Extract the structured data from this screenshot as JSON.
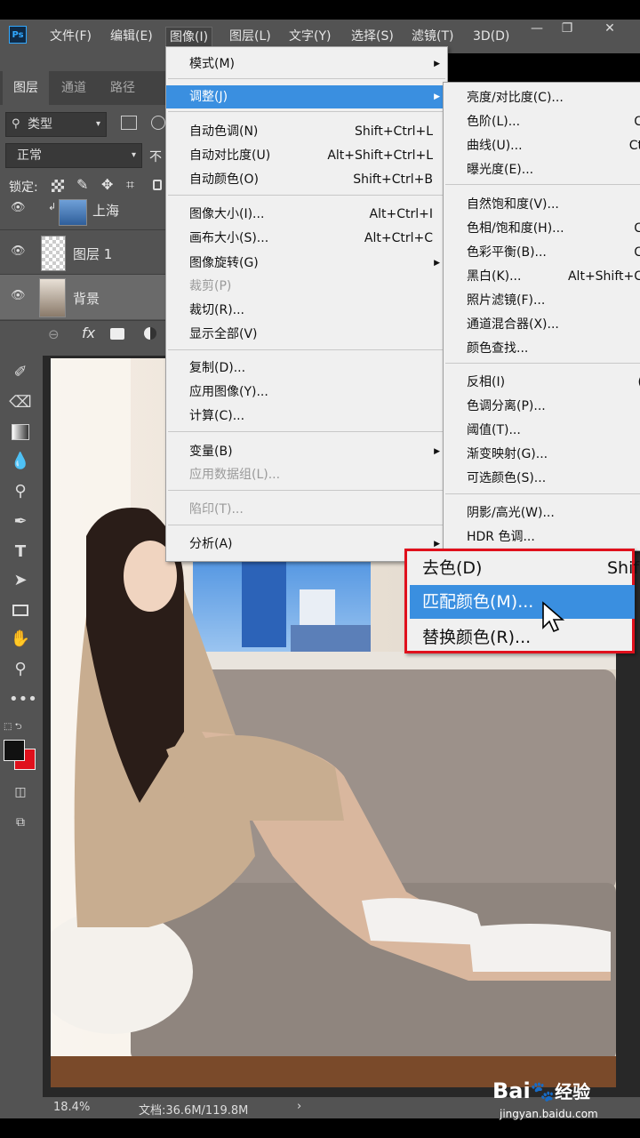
{
  "app": {
    "logo": "Ps"
  },
  "menubar": [
    "文件(F)",
    "编辑(E)",
    "图像(I)",
    "图层(L)",
    "文字(Y)",
    "选择(S)",
    "滤镜(T)",
    "3D(D)"
  ],
  "window_controls": [
    "—",
    "❐",
    "✕"
  ],
  "layers_panel": {
    "tabs": [
      "图层",
      "通道",
      "路径"
    ],
    "filter_label": "类型",
    "blend_mode": "正常",
    "opacity_label": "不",
    "lock_label": "锁定:",
    "layers": [
      {
        "name": "上海"
      },
      {
        "name": "图层 1"
      },
      {
        "name": "背景"
      }
    ],
    "footer_icons": [
      "link-icon",
      "fx-icon",
      "mask-icon",
      "adjustment-icon"
    ],
    "fx_label": "fx"
  },
  "image_menu": {
    "items": [
      {
        "label": "模式(M)",
        "shortcut": "",
        "submenu": true
      },
      {
        "label": "调整(J)",
        "shortcut": "",
        "submenu": true
      },
      {
        "label": "自动色调(N)",
        "shortcut": "Shift+Ctrl+L"
      },
      {
        "label": "自动对比度(U)",
        "shortcut": "Alt+Shift+Ctrl+L"
      },
      {
        "label": "自动颜色(O)",
        "shortcut": "Shift+Ctrl+B"
      },
      {
        "label": "图像大小(I)...",
        "shortcut": "Alt+Ctrl+I"
      },
      {
        "label": "画布大小(S)...",
        "shortcut": "Alt+Ctrl+C"
      },
      {
        "label": "图像旋转(G)",
        "shortcut": "",
        "submenu": true
      },
      {
        "label": "裁剪(P)",
        "shortcut": ""
      },
      {
        "label": "裁切(R)...",
        "shortcut": ""
      },
      {
        "label": "显示全部(V)",
        "shortcut": ""
      },
      {
        "label": "复制(D)...",
        "shortcut": ""
      },
      {
        "label": "应用图像(Y)...",
        "shortcut": ""
      },
      {
        "label": "计算(C)...",
        "shortcut": ""
      },
      {
        "label": "变量(B)",
        "shortcut": "",
        "submenu": true
      },
      {
        "label": "应用数据组(L)...",
        "shortcut": ""
      },
      {
        "label": "陷印(T)...",
        "shortcut": ""
      },
      {
        "label": "分析(A)",
        "shortcut": "",
        "submenu": true
      }
    ]
  },
  "adjust_submenu": {
    "items": [
      {
        "label": "亮度/对比度(C)...",
        "shortcut": ""
      },
      {
        "label": "色阶(L)...",
        "shortcut": "C"
      },
      {
        "label": "曲线(U)...",
        "shortcut": "Ct"
      },
      {
        "label": "曝光度(E)...",
        "shortcut": ""
      },
      {
        "label": "自然饱和度(V)...",
        "shortcut": ""
      },
      {
        "label": "色相/饱和度(H)...",
        "shortcut": "C"
      },
      {
        "label": "色彩平衡(B)...",
        "shortcut": "C"
      },
      {
        "label": "黑白(K)...",
        "shortcut": "Alt+Shift+C"
      },
      {
        "label": "照片滤镜(F)...",
        "shortcut": ""
      },
      {
        "label": "通道混合器(X)...",
        "shortcut": ""
      },
      {
        "label": "颜色查找...",
        "shortcut": ""
      },
      {
        "label": "反相(I)",
        "shortcut": "("
      },
      {
        "label": "色调分离(P)...",
        "shortcut": ""
      },
      {
        "label": "阈值(T)...",
        "shortcut": ""
      },
      {
        "label": "渐变映射(G)...",
        "shortcut": ""
      },
      {
        "label": "可选颜色(S)...",
        "shortcut": ""
      },
      {
        "label": "阴影/高光(W)...",
        "shortcut": ""
      },
      {
        "label": "HDR 色调...",
        "shortcut": ""
      }
    ]
  },
  "zoomed_items": [
    {
      "label": "去色(D)",
      "shortcut": "Shif"
    },
    {
      "label": "匹配颜色(M)...",
      "shortcut": ""
    },
    {
      "label": "替换颜色(R)...",
      "shortcut": ""
    }
  ],
  "status": {
    "zoom": "18.4%",
    "doc": "文档:36.6M/119.8M",
    "arrow": "›"
  },
  "watermark": {
    "brand": "Bai",
    "brand2": "经验",
    "url": "jingyan.baidu.com"
  },
  "colors": {
    "highlight": "#3a8fe0",
    "red_box": "#e0101c",
    "foreground": "#111111",
    "background": "#e0101c"
  }
}
